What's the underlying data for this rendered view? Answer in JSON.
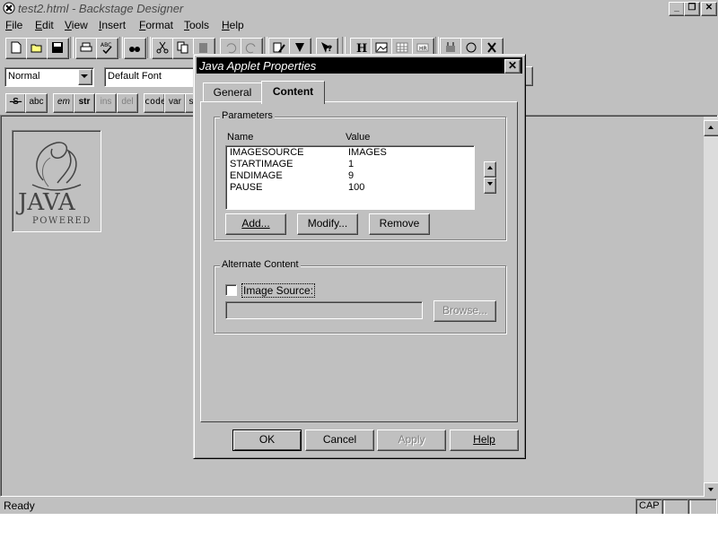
{
  "window": {
    "title": "test2.html - Backstage Designer"
  },
  "menu": [
    {
      "label": "File",
      "u": "F",
      "rest": "ile"
    },
    {
      "label": "Edit",
      "u": "E",
      "rest": "dit"
    },
    {
      "label": "View",
      "u": "V",
      "rest": "iew"
    },
    {
      "label": "Insert",
      "u": "I",
      "rest": "nsert"
    },
    {
      "label": "Format",
      "u": "F",
      "rest": "ormat"
    },
    {
      "label": "Tools",
      "u": "T",
      "rest": "ools"
    },
    {
      "label": "Help",
      "u": "H",
      "rest": "elp"
    }
  ],
  "format_bar": {
    "style_value": "Normal",
    "font_value": "Default Font",
    "buttons": [
      "-S-",
      "abc",
      "em",
      "str",
      "ins",
      "del",
      "code",
      "var",
      "s"
    ]
  },
  "statusbar": {
    "status": "Ready",
    "cap": "CAP"
  },
  "dialog": {
    "title": "Java Applet Properties",
    "tabs": {
      "general": "General",
      "content": "Content"
    },
    "parameters": {
      "label": "Parameters",
      "col_name": "Name",
      "col_value": "Value",
      "rows": [
        {
          "name": "IMAGESOURCE",
          "value": "IMAGES"
        },
        {
          "name": "STARTIMAGE",
          "value": "1"
        },
        {
          "name": "ENDIMAGE",
          "value": "9"
        },
        {
          "name": "PAUSE",
          "value": "100"
        }
      ],
      "add": "Add...",
      "modify": "Modify...",
      "remove": "Remove"
    },
    "alternate": {
      "label": "Alternate Content",
      "checkbox_label": "Image Source:",
      "image_source_value": "",
      "browse": "Browse..."
    },
    "buttons": {
      "ok": "OK",
      "cancel": "Cancel",
      "apply": "Apply",
      "help": "Help"
    }
  },
  "logo": {
    "brand": "JAVA",
    "tagline": "POWERED"
  }
}
